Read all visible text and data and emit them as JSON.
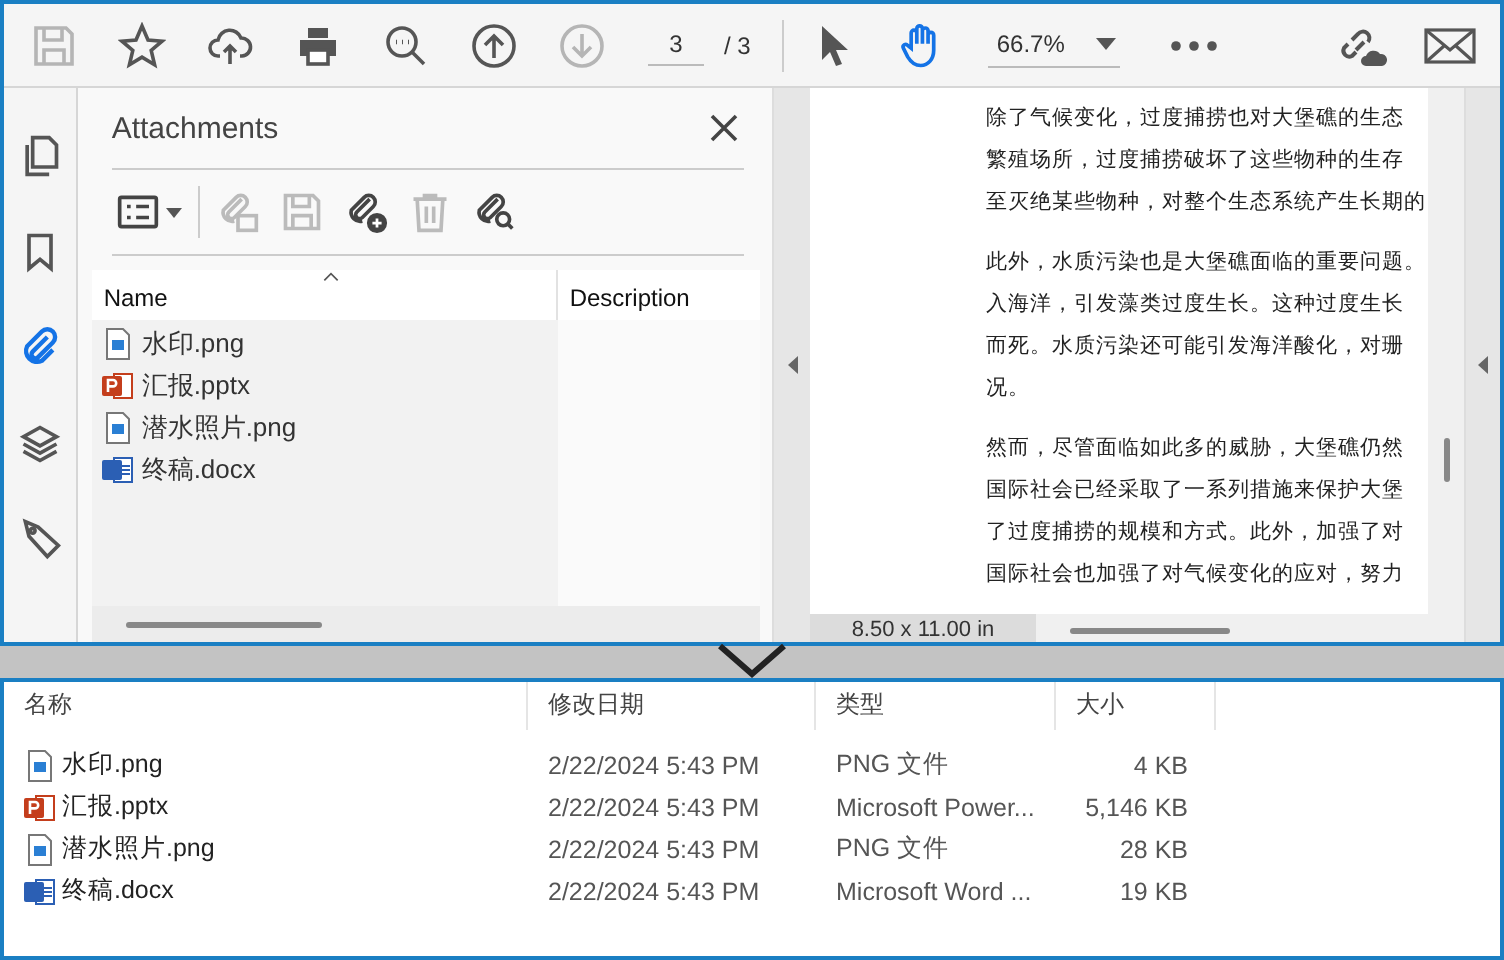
{
  "toolbar": {
    "tools": [
      {
        "kind": "save",
        "disabled": true
      },
      {
        "kind": "star",
        "disabled": false
      },
      {
        "kind": "upload",
        "disabled": false
      },
      {
        "kind": "print",
        "disabled": false
      },
      {
        "kind": "zoom",
        "disabled": false
      },
      {
        "kind": "up",
        "disabled": false
      },
      {
        "kind": "down",
        "disabled": true
      }
    ],
    "page_input": "3",
    "page_total": "/ 3",
    "modes": [
      {
        "kind": "pointer",
        "selected": false
      },
      {
        "kind": "hand",
        "selected": true
      }
    ],
    "zoom_value": "66.7%"
  },
  "side_rail": [
    {
      "kind": "pages",
      "selected": false
    },
    {
      "kind": "bookmark",
      "selected": false
    },
    {
      "kind": "attachment",
      "selected": true
    },
    {
      "kind": "layers",
      "selected": false
    },
    {
      "kind": "tag",
      "selected": false
    }
  ],
  "attachments": {
    "title": "Attachments",
    "tools": [
      {
        "kind": "view",
        "disabled": false
      },
      {
        "kind": "open",
        "disabled": true
      },
      {
        "kind": "save",
        "disabled": true
      },
      {
        "kind": "add",
        "disabled": false
      },
      {
        "kind": "delete",
        "disabled": true
      },
      {
        "kind": "search",
        "disabled": false
      }
    ],
    "columns": [
      "Name",
      "Description"
    ],
    "files": [
      {
        "kind": "image",
        "name": "水印.png"
      },
      {
        "kind": "pptx",
        "name": "汇报.pptx"
      },
      {
        "kind": "image",
        "name": "潜水照片.png"
      },
      {
        "kind": "docx",
        "name": "终稿.docx"
      }
    ]
  },
  "document": {
    "paragraphs": [
      [
        "除了气候变化，过度捕捞也对大堡礁的生态",
        "繁殖场所，过度捕捞破坏了这些物种的生存",
        "至灭绝某些物种，对整个生态系统产生长期的"
      ],
      [
        "此外，水质污染也是大堡礁面临的重要问题。",
        "入海洋，引发藻类过度生长。这种过度生长",
        "而死。水质污染还可能引发海洋酸化，对珊",
        "况。"
      ],
      [
        "然而，尽管面临如此多的威胁，大堡礁仍然",
        "国际社会已经采取了一系列措施来保护大堡",
        "了过度捕捞的规模和方式。此外，加强了对",
        "国际社会也加强了对气候变化的应对，努力"
      ]
    ],
    "page_size": "8.50 x 11.00 in"
  },
  "explorer": {
    "columns": [
      "名称",
      "修改日期",
      "类型",
      "大小"
    ],
    "rows": [
      {
        "kind": "image",
        "name": "水印.png",
        "modified": "2/22/2024 5:43 PM",
        "type": "PNG 文件",
        "size": "4 KB"
      },
      {
        "kind": "pptx",
        "name": "汇报.pptx",
        "modified": "2/22/2024 5:43 PM",
        "type": "Microsoft Power...",
        "size": "5,146 KB"
      },
      {
        "kind": "image",
        "name": "潜水照片.png",
        "modified": "2/22/2024 5:43 PM",
        "type": "PNG 文件",
        "size": "28 KB"
      },
      {
        "kind": "docx",
        "name": "终稿.docx",
        "modified": "2/22/2024 5:43 PM",
        "type": "Microsoft Word ...",
        "size": "19 KB"
      }
    ]
  }
}
